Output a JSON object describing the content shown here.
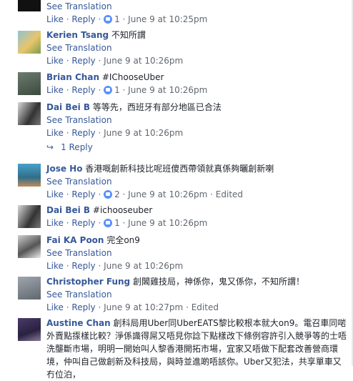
{
  "labels": {
    "see_translation": "See Translation",
    "like": "Like",
    "reply": "Reply",
    "dot": " · "
  },
  "top_fragment": {
    "reactions": "1",
    "time": "June 9 at 10:25pm"
  },
  "comments": [
    {
      "name": "Kerien Tsang",
      "text": "不知所謂",
      "translation": true,
      "reactions": "",
      "time": "June 9 at 10:26pm",
      "edited": ""
    },
    {
      "name": "Brian Chan",
      "text": "#IChooseUber",
      "translation": false,
      "reactions": "1",
      "time": "June 9 at 10:26pm",
      "edited": ""
    },
    {
      "name": "Dai Bei B",
      "text": "等等先，西班牙有部分地區已合法",
      "translation": true,
      "reactions": "",
      "time": "June 9 at 10:26pm",
      "edited": ""
    },
    {
      "name": "Jose Ho",
      "text": "香港嘅創新科技比呢班傻西帶領就真係夠曬創新喇",
      "translation": true,
      "reactions": "2",
      "time": "June 9 at 10:26pm",
      "edited": "Edited"
    },
    {
      "name": "Dai Bei B",
      "text": "#ichooseuber",
      "translation": false,
      "reactions": "1",
      "time": "June 9 at 10:26pm",
      "edited": ""
    },
    {
      "name": "Fai KA Poon",
      "text": "完全on9",
      "translation": true,
      "reactions": "",
      "time": "June 9 at 10:26pm",
      "edited": ""
    },
    {
      "name": "Christopher Fung",
      "text": "創閪雞技局，神係你，鬼又係你，不知所謂！",
      "translation": true,
      "reactions": "",
      "time": "June 9 at 10:27pm",
      "edited": "Edited"
    },
    {
      "name": "Austine Chan",
      "text": "創科局用Uber同UberEATS黎比較根本就大on9。電召車同啱外賣點揼樣比較？淨係識得屌又唔見你諗下點樣改下條例容許引入競爭等的士唔洗壟斷市場，明明一開始叫人黎香港開拓市場，宜家又唔做下配套改善營商環境，仲叫自己做創新及科技局，與時並進啲唔該你。Uber又犯法，共享單車又冇位泊，",
      "translation": false,
      "reactions": "",
      "time": "",
      "edited": ""
    }
  ],
  "reply_link": "1 Reply",
  "icons": {
    "like": "like-thumb-icon",
    "reply_arrow": "reply-arrow-icon"
  },
  "colors": {
    "link": "#365899",
    "meta": "#616770",
    "like_badge": "#5890ff"
  }
}
